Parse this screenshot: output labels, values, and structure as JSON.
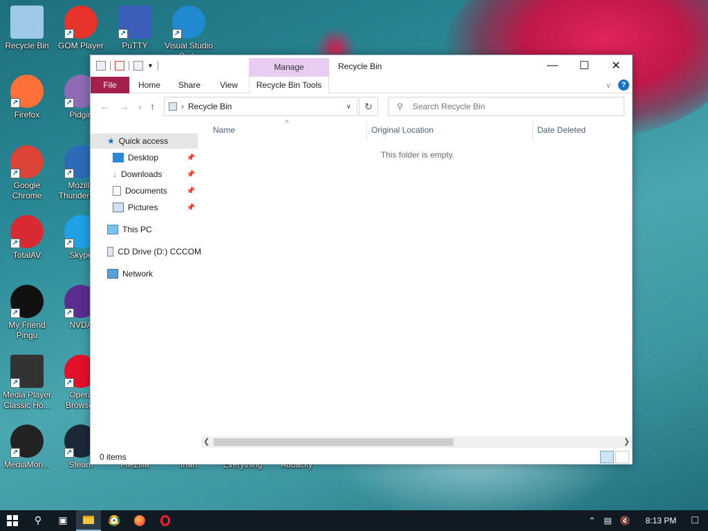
{
  "desktop": {
    "icons": [
      {
        "label": "Recycle Bin",
        "icon": "recycle-bin-icon"
      },
      {
        "label": "GOM Player",
        "icon": "gom-player-icon"
      },
      {
        "label": "PuTTY",
        "icon": "putty-icon"
      },
      {
        "label": "Visual Studio Code",
        "icon": "vscode-icon"
      },
      {
        "label": "Firefox",
        "icon": "firefox-icon"
      },
      {
        "label": "Pidgin",
        "icon": "pidgin-icon"
      },
      {
        "label": "Google Chrome",
        "icon": "chrome-icon"
      },
      {
        "label": "Mozilla Thunderbird",
        "icon": "thunderbird-icon"
      },
      {
        "label": "TotalAV",
        "icon": "totalav-icon"
      },
      {
        "label": "Skype",
        "icon": "skype-icon"
      },
      {
        "label": "My Friend Pingu",
        "icon": "pingu-icon"
      },
      {
        "label": "NVDA",
        "icon": "nvda-icon"
      },
      {
        "label": "Media Player Classic Ho...",
        "icon": "mpc-icon"
      },
      {
        "label": "Opera Browser",
        "icon": "opera-icon"
      },
      {
        "label": "MediaMon...",
        "icon": "mediamonkey-icon"
      },
      {
        "label": "Steam",
        "icon": "steam-icon"
      },
      {
        "label": "FileZilla",
        "icon": "filezilla-icon"
      },
      {
        "label": "Irfan",
        "icon": "irfanview-icon"
      },
      {
        "label": "Everything",
        "icon": "everything-icon"
      },
      {
        "label": "Audacity",
        "icon": "audacity-icon"
      }
    ]
  },
  "window": {
    "title": "Recycle Bin",
    "manage_tab": "Manage",
    "tabs": {
      "file": "File",
      "home": "Home",
      "share": "Share",
      "view": "View",
      "tools": "Recycle Bin Tools"
    },
    "address": "Recycle Bin",
    "search_placeholder": "Search Recycle Bin",
    "help": "?",
    "nav": {
      "quick_access": "Quick access",
      "desktop": "Desktop",
      "downloads": "Downloads",
      "documents": "Documents",
      "pictures": "Pictures",
      "this_pc": "This PC",
      "cd_drive": "CD Drive (D:) CCCOM",
      "network": "Network"
    },
    "columns": {
      "name": "Name",
      "original_location": "Original Location",
      "date_deleted": "Date Deleted"
    },
    "empty_message": "This folder is empty.",
    "status": "0 items"
  },
  "taskbar": {
    "clock": "8:13 PM"
  },
  "colors": {
    "file_tab": "#a51f4d",
    "manage_tab": "#e9cdf0",
    "accent": "#1a6fc7"
  }
}
